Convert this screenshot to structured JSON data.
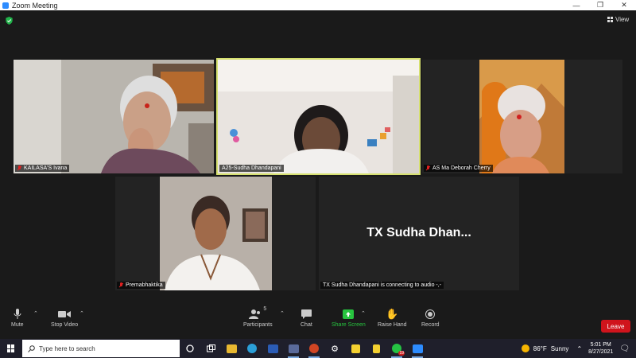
{
  "window": {
    "title": "Zoom Meeting"
  },
  "header": {
    "view_label": "View"
  },
  "participants_grid": [
    {
      "name": "KAILASA'S Ivana",
      "muted": true
    },
    {
      "name": "A25-Sudha Dhandapani",
      "muted": false,
      "active_speaker": true
    },
    {
      "name": "AS Ma Deborah Cherry",
      "muted": true
    },
    {
      "name": "Premabhaktika",
      "muted": true
    },
    {
      "name": "TX Sudha Dhandapani is connecting to audio -,-",
      "display_name": "TX Sudha Dhan...",
      "muted": false
    }
  ],
  "toolbar": {
    "mute": "Mute",
    "stop_video": "Stop Video",
    "participants": "Participants",
    "participants_count": "5",
    "chat": "Chat",
    "share_screen": "Share Screen",
    "raise_hand": "Raise Hand",
    "record": "Record",
    "leave": "Leave"
  },
  "taskbar": {
    "search_placeholder": "Type here to search",
    "whatsapp_badge": "19",
    "weather_temp": "86°F",
    "weather_desc": "Sunny",
    "time": "5:01 PM",
    "date": "8/27/2021"
  },
  "colors": {
    "active_speaker_border": "#d6e070",
    "leave_button": "#d0141c",
    "share_screen": "#27c43f",
    "muted_mic": "#e02020"
  }
}
